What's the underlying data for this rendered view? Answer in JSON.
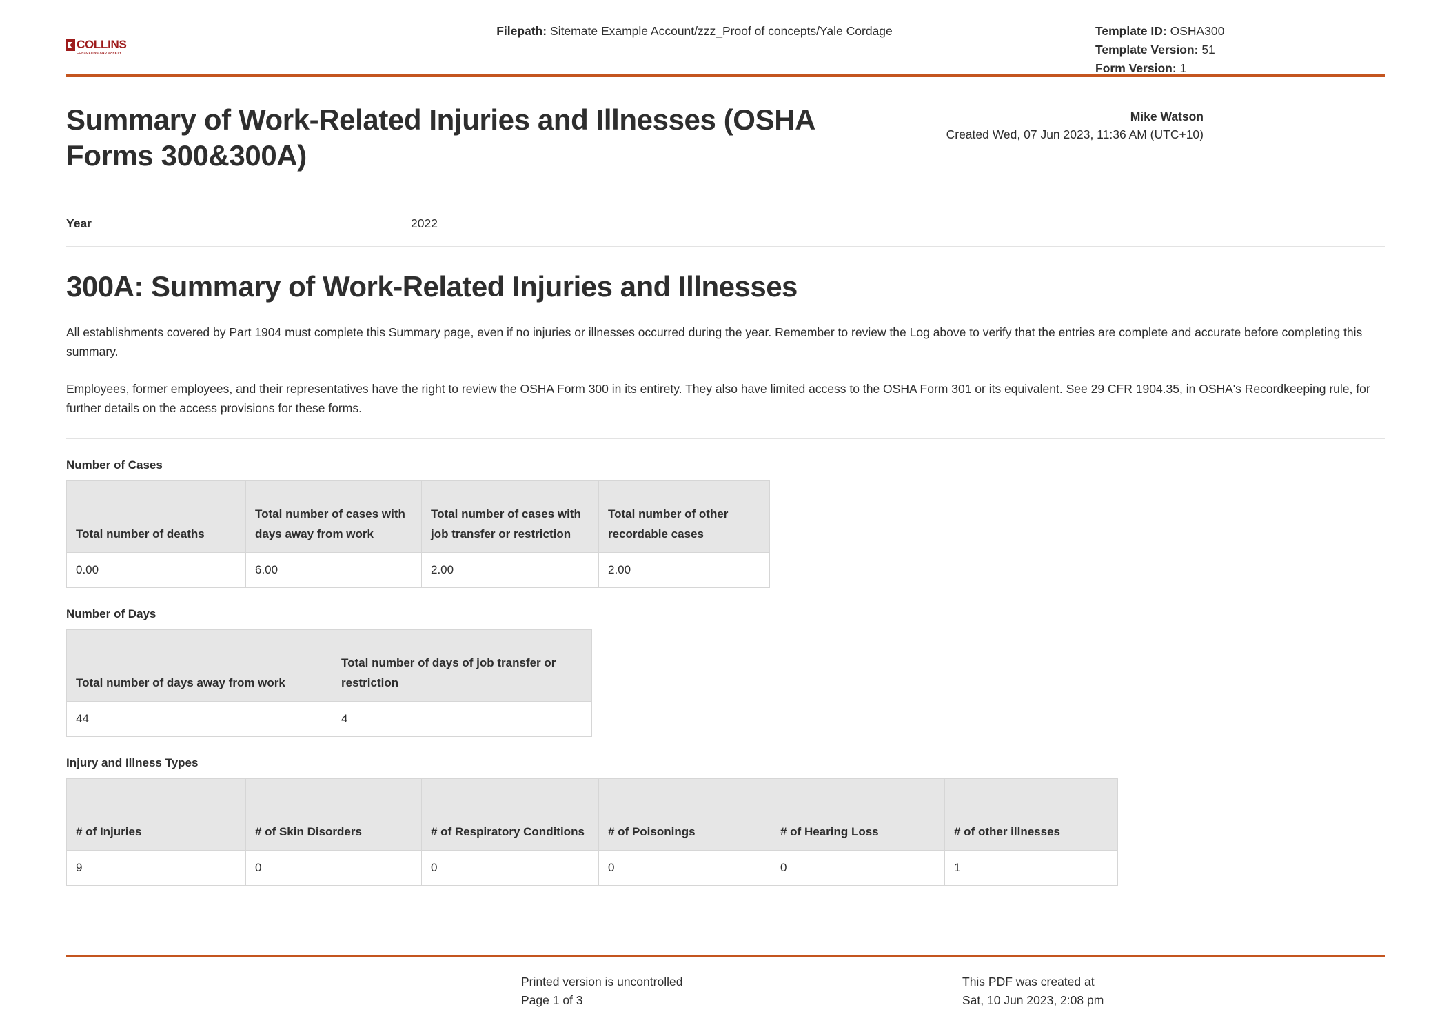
{
  "header": {
    "logo": {
      "word": "COLLINS",
      "subtitle": "CONSULTING AND SAFETY",
      "icon": "collins-logo-mark"
    },
    "filepath_label": "Filepath:",
    "filepath_value": "Sitemate Example Account/zzz_Proof of concepts/Yale Cordage",
    "template_id_label": "Template ID:",
    "template_id_value": "OSHA300",
    "template_version_label": "Template Version:",
    "template_version_value": "51",
    "form_version_label": "Form Version:",
    "form_version_value": "1"
  },
  "title": {
    "heading": "Summary of Work-Related Injuries and Illnesses (OSHA Forms 300&300A)",
    "author": "Mike Watson",
    "created": "Created Wed, 07 Jun 2023, 11:36 AM (UTC+10)"
  },
  "year_field": {
    "label": "Year",
    "value": "2022"
  },
  "section": {
    "heading": "300A: Summary of Work-Related Injuries and Illnesses",
    "paragraph_1": "All establishments covered by Part 1904 must complete this Summary page, even if no injuries or illnesses occurred during the year. Remember to review the Log above to verify that the entries are complete and accurate before completing this summary.",
    "paragraph_2": "Employees, former employees, and their representatives have the right to review the OSHA Form 300 in its entirety. They also have limited access to the OSHA Form 301 or its equivalent. See 29 CFR 1904.35, in OSHA's Recordkeeping rule, for further details on the access provisions for these forms."
  },
  "tables": {
    "number_of_cases": {
      "label": "Number of Cases",
      "headers": [
        "Total number of deaths",
        "Total number of cases with days away from work",
        "Total number of cases with job transfer or restriction",
        "Total number of other recordable cases"
      ],
      "values": [
        "0.00",
        "6.00",
        "2.00",
        "2.00"
      ]
    },
    "number_of_days": {
      "label": "Number of Days",
      "headers": [
        "Total number of days away from work",
        "Total number of days of job transfer or restriction"
      ],
      "values": [
        "44",
        "4"
      ]
    },
    "injury_illness_types": {
      "label": "Injury and Illness Types",
      "headers": [
        "# of Injuries",
        "# of Skin Disorders",
        "# of Respiratory Conditions",
        "# of Poisonings",
        "# of Hearing Loss",
        "# of other illnesses"
      ],
      "values": [
        "9",
        "0",
        "0",
        "0",
        "0",
        "1"
      ]
    }
  },
  "footer": {
    "printed_notice": "Printed version is uncontrolled",
    "page_number": "Page 1 of 3",
    "pdf_notice": "This PDF was created at",
    "pdf_date": "Sat, 10 Jun 2023, 2:08 pm"
  },
  "colors": {
    "accent_rule": "#c4551f",
    "logo_red": "#9e1b1b",
    "table_header_bg": "#e6e6e6",
    "table_border": "#d6d6d6",
    "text": "#2e2e2e"
  }
}
